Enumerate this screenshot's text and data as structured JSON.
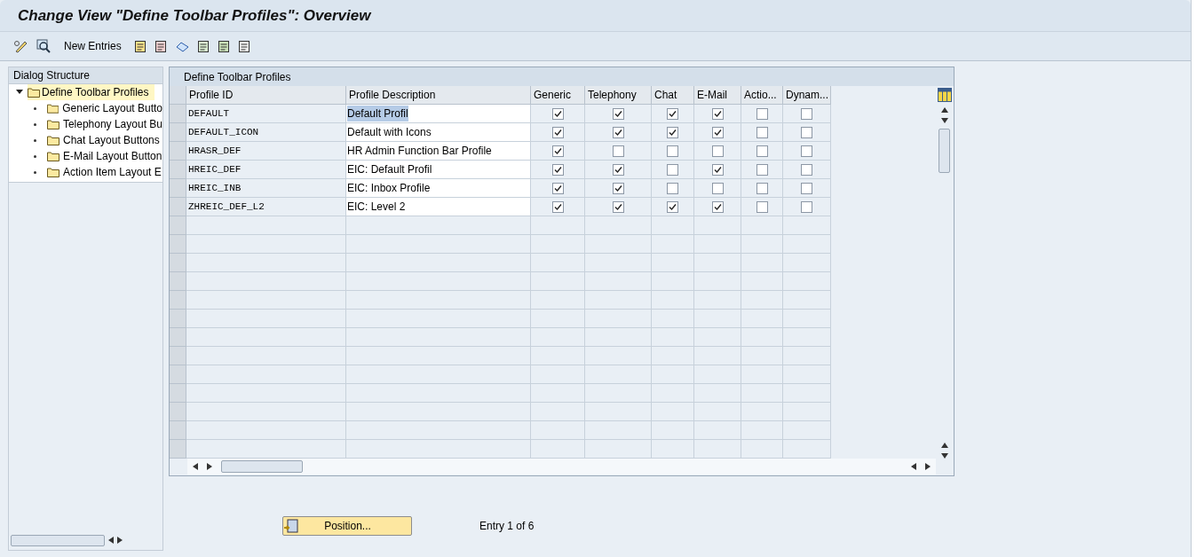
{
  "window": {
    "title": "Change View \"Define Toolbar Profiles\": Overview"
  },
  "toolbar": {
    "new_entries": "New Entries"
  },
  "dialog_structure": {
    "title": "Dialog Structure",
    "items": [
      {
        "label": "Define Toolbar Profiles",
        "expanded": true,
        "selected": true,
        "children": [
          {
            "label": "Generic Layout Butto",
            "selected": false
          },
          {
            "label": "Telephony Layout Bu",
            "selected": false
          },
          {
            "label": "Chat Layout Buttons",
            "selected": false
          },
          {
            "label": "E-Mail Layout Button",
            "selected": false
          },
          {
            "label": "Action Item Layout E",
            "selected": false
          }
        ]
      }
    ]
  },
  "table": {
    "title": "Define Toolbar Profiles",
    "columns": [
      {
        "label": "Profile ID",
        "kind": "mono"
      },
      {
        "label": "Profile Description",
        "kind": "input"
      },
      {
        "label": "Generic",
        "kind": "check"
      },
      {
        "label": "Telephony",
        "kind": "check"
      },
      {
        "label": "Chat",
        "kind": "check"
      },
      {
        "label": "E-Mail",
        "kind": "check"
      },
      {
        "label": "Actio...",
        "kind": "check"
      },
      {
        "label": "Dynam...",
        "kind": "check"
      }
    ],
    "rows": [
      {
        "highlighted": true,
        "values": [
          "DEFAULT",
          "Default Profil",
          true,
          true,
          true,
          true,
          false,
          false
        ]
      },
      {
        "highlighted": false,
        "values": [
          "DEFAULT_ICON",
          "Default with Icons",
          true,
          true,
          true,
          true,
          false,
          false
        ]
      },
      {
        "highlighted": false,
        "values": [
          "HRASR_DEF",
          "HR Admin Function Bar Profile",
          true,
          false,
          false,
          false,
          false,
          false
        ]
      },
      {
        "highlighted": false,
        "values": [
          "HREIC_DEF",
          "EIC: Default Profil",
          true,
          true,
          false,
          true,
          false,
          false
        ]
      },
      {
        "highlighted": false,
        "values": [
          "HREIC_INB",
          "EIC: Inbox Profile",
          true,
          true,
          false,
          false,
          false,
          false
        ]
      },
      {
        "highlighted": false,
        "values": [
          "ZHREIC_DEF_L2",
          "EIC: Level 2",
          true,
          true,
          true,
          true,
          false,
          false
        ]
      }
    ]
  },
  "footer": {
    "position_button": "Position...",
    "entry_info": "Entry 1 of 6"
  }
}
